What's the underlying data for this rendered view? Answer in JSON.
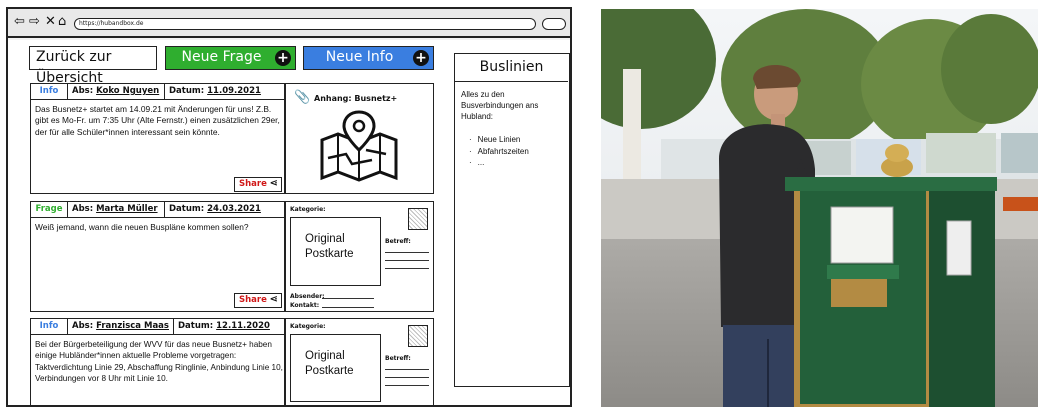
{
  "browser": {
    "url": "https://hubandbox.de"
  },
  "toolbar": {
    "back_label": "Zurück zur Übersicht",
    "new_question_label": "Neue Frage",
    "new_info_label": "Neue Info"
  },
  "colors": {
    "info_blue": "#3a7ee0",
    "frage_green": "#2fae2f",
    "share_red": "#d01818"
  },
  "icons": {
    "browser": [
      "back-arrow-icon",
      "forward-arrow-icon",
      "close-icon",
      "home-icon"
    ],
    "plus": "plus-circle-icon",
    "share": "share-icon",
    "attachment": "paperclip-icon",
    "map": "map-pin-icon"
  },
  "posts": [
    {
      "type": "Info",
      "from_label": "Abs:",
      "from": "Koko Nguyen",
      "date_label": "Datum:",
      "date": "11.09.2021",
      "text": "Das Busnetz+ startet am 14.09.21 mit Änderungen für uns! Z.B. gibt es Mo-Fr. um 7:35 Uhr (Alte Fernstr.) einen zusätzlichen 29er, der für alle Schüler*innen interessant sein könnte.",
      "share": "Share",
      "attachment": "Anhang: Busnetz+"
    },
    {
      "type": "Frage",
      "from_label": "Abs:",
      "from": "Marta Müller",
      "date_label": "Datum:",
      "date": "24.03.2021",
      "text": "Weiß jemand, wann die neuen Buspläne kommen sollen?",
      "share": "Share",
      "postcard": {
        "kategorie": "Kategorie:",
        "title": "Original Postkarte",
        "betreff": "Betreff:",
        "absender": "Absender:",
        "kontakt": "Kontakt:"
      }
    },
    {
      "type": "Info",
      "from_label": "Abs:",
      "from": "Franzisca Maas",
      "date_label": "Datum:",
      "date": "12.11.2020",
      "text": "Bei der Bürgerbeteiligung der WVV für das neue Busnetz+ haben einige Hubländer*innen aktuelle Probleme vorgetragen: Taktverdichtung Linie 29, Abschaffung Ringlinie, Anbindung Linie 10, Verbindungen vor 8 Uhr mit Linie 10.",
      "postcard": {
        "kategorie": "Kategorie:",
        "title": "Original Postkarte",
        "betreff": "Betreff:"
      }
    }
  ],
  "sidebar": {
    "title": "Buslinien",
    "description": "Alles zu den Busverbindungen ans Hubland:",
    "items": [
      "Neue Linien",
      "Abfahrtszeiten",
      "..."
    ]
  }
}
